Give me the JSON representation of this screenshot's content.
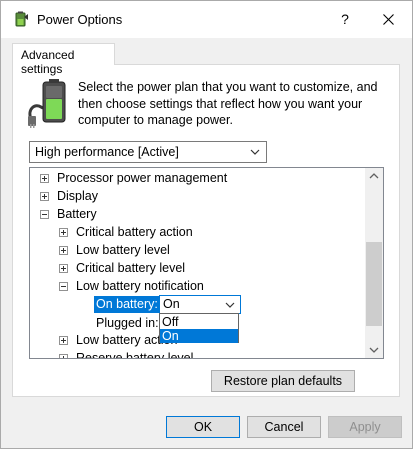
{
  "window": {
    "title": "Power Options",
    "help_label": "?",
    "close_label": "✕"
  },
  "tab": {
    "label": "Advanced settings"
  },
  "description": "Select the power plan that you want to customize, and then choose settings that reflect how you want your computer to manage power.",
  "plan_select": {
    "value": "High performance [Active]"
  },
  "tree": {
    "items": [
      {
        "label": "Processor power management",
        "expander": "plus"
      },
      {
        "label": "Display",
        "expander": "plus"
      },
      {
        "label": "Battery",
        "expander": "minus"
      },
      {
        "label": "Critical battery action",
        "expander": "plus"
      },
      {
        "label": "Low battery level",
        "expander": "plus"
      },
      {
        "label": "Critical battery level",
        "expander": "plus"
      },
      {
        "label": "Low battery notification",
        "expander": "minus"
      },
      {
        "label": "Low battery action",
        "expander": "plus"
      },
      {
        "label": "Reserve battery level",
        "expander": "plus"
      }
    ],
    "on_battery": {
      "label": "On battery:",
      "value": "On"
    },
    "plugged_in": {
      "label": "Plugged in:"
    }
  },
  "dropdown_options": [
    "Off",
    "On"
  ],
  "dropdown_selected": "On",
  "buttons": {
    "restore": "Restore plan defaults",
    "ok": "OK",
    "cancel": "Cancel",
    "apply": "Apply"
  },
  "colors": {
    "accent": "#0078d7",
    "window_bg": "#f0f0f0"
  }
}
